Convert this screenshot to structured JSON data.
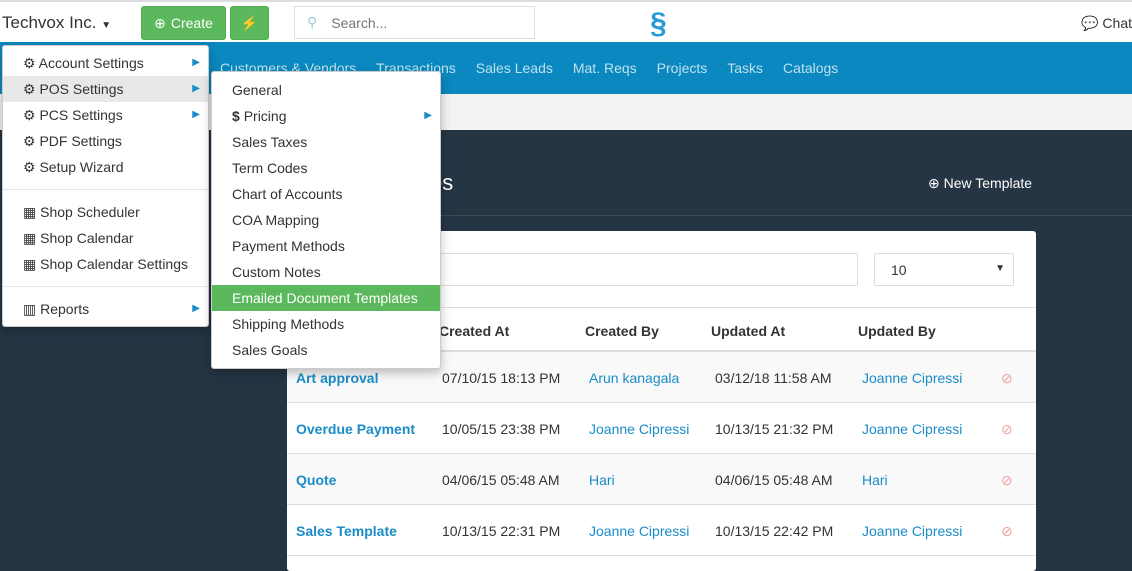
{
  "top": {
    "brand": "Techvox Inc.",
    "create": "Create",
    "search_placeholder": "Search...",
    "chat": "Chat"
  },
  "nav": [
    "Customers & Vendors",
    "Transactions",
    "Sales Leads",
    "Mat. Reqs",
    "Projects",
    "Tasks",
    "Catalogs"
  ],
  "page": {
    "title": "es",
    "new_template": "New Template",
    "page_size": "10"
  },
  "table": {
    "headers": [
      "Created At",
      "Created By",
      "Updated At",
      "Updated By"
    ],
    "rows": [
      [
        "Art approval",
        "07/10/15 18:13 PM",
        "Arun kanagala",
        "03/12/18 11:58 AM",
        "Joanne Cipressi"
      ],
      [
        "Overdue Payment",
        "10/05/15 23:38 PM",
        "Joanne Cipressi",
        "10/13/15 21:32 PM",
        "Joanne Cipressi"
      ],
      [
        "Quote",
        "04/06/15 05:48 AM",
        "Hari",
        "04/06/15 05:48 AM",
        "Hari"
      ],
      [
        "Sales Template",
        "10/13/15 22:31 PM",
        "Joanne Cipressi",
        "10/13/15 22:42 PM",
        "Joanne Cipressi"
      ]
    ]
  },
  "menu": {
    "items": [
      "Account Settings",
      "POS Settings",
      "PCS Settings",
      "PDF Settings",
      "Setup Wizard",
      "Shop Scheduler",
      "Shop Calendar",
      "Shop Calendar Settings",
      "Reports"
    ]
  },
  "submenu": {
    "items": [
      "General",
      "Pricing",
      "Sales Taxes",
      "Term Codes",
      "Chart of Accounts",
      "COA Mapping",
      "Payment Methods",
      "Custom Notes",
      "Emailed Document Templates",
      "Shipping Methods",
      "Sales Goals"
    ]
  }
}
